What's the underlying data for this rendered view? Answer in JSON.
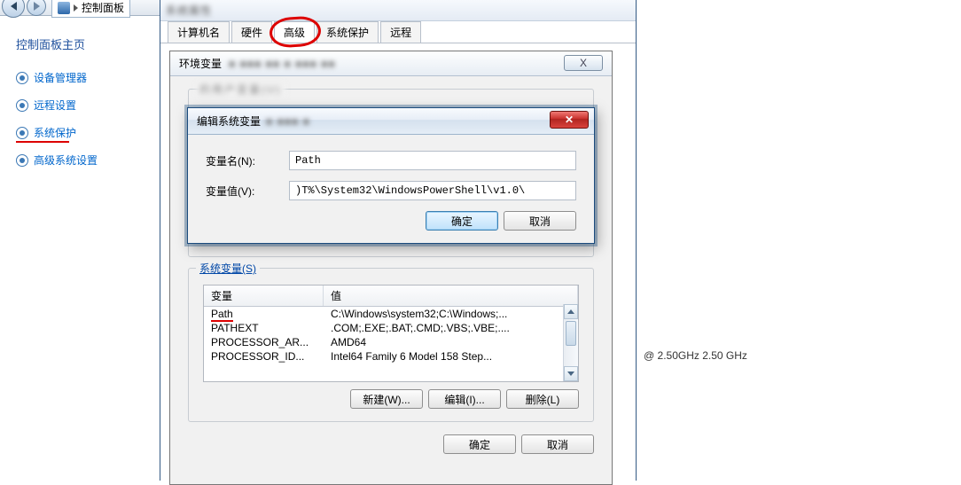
{
  "breadcrumb": {
    "text": "控制面板"
  },
  "sysprops_title": "系统属性",
  "sidebar": {
    "title": "控制面板主页",
    "items": [
      {
        "label": "设备管理器"
      },
      {
        "label": "远程设置"
      },
      {
        "label": "系统保护"
      },
      {
        "label": "高级系统设置"
      }
    ]
  },
  "tabs": [
    {
      "label": "计算机名"
    },
    {
      "label": "硬件"
    },
    {
      "label": "高级"
    },
    {
      "label": "系统保护"
    },
    {
      "label": "远程"
    }
  ],
  "env_dialog": {
    "title": "环境变量",
    "close": "X",
    "user_group_blur": "的用户变量(U)",
    "sys_group_legend": "系统变量(S)",
    "columns": {
      "c1": "变量",
      "c2": "值"
    },
    "sys_rows": [
      {
        "name": "Path",
        "value": "C:\\Windows\\system32;C:\\Windows;..."
      },
      {
        "name": "PATHEXT",
        "value": ".COM;.EXE;.BAT;.CMD;.VBS;.VBE;...."
      },
      {
        "name": "PROCESSOR_AR...",
        "value": "AMD64"
      },
      {
        "name": "PROCESSOR_ID...",
        "value": "Intel64 Family 6 Model 158 Step..."
      }
    ],
    "buttons": {
      "new": "新建(W)...",
      "edit": "编辑(I)...",
      "del": "删除(L)",
      "ok": "确定",
      "cancel": "取消"
    }
  },
  "edit_dialog": {
    "title": "编辑系统变量",
    "name_label": "变量名(N):",
    "value_label": "变量值(V):",
    "name_value": "Path",
    "value_value": ")T%\\System32\\WindowsPowerShell\\v1.0\\",
    "ok": "确定",
    "cancel": "取消",
    "close_glyph": "✕"
  },
  "cpu": "@ 2.50GHz   2.50 GHz"
}
